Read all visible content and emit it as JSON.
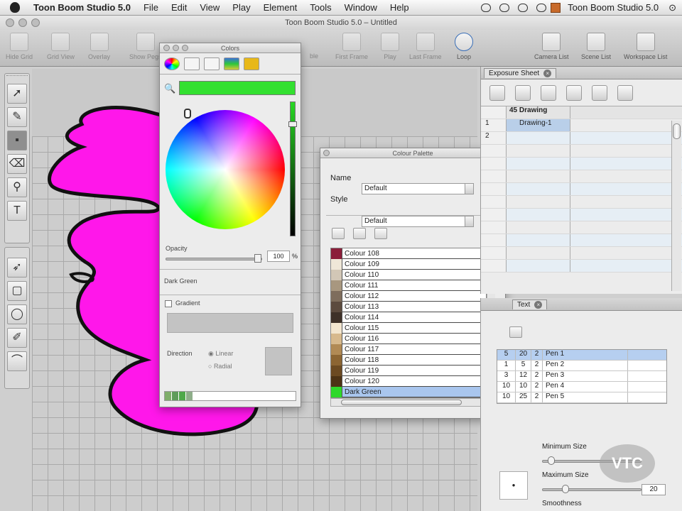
{
  "menubar": {
    "app": "Toon Boom Studio 5.0",
    "items": [
      "File",
      "Edit",
      "View",
      "Play",
      "Element",
      "Tools",
      "Window",
      "Help"
    ],
    "right_app": "Toon Boom Studio 5.0"
  },
  "window_title": "Toon Boom Studio 5.0 – Untitled",
  "toolbar": {
    "left": [
      "Hide Grid",
      "Grid View",
      "Overlay",
      "Show Pegs"
    ],
    "frame_controls": [
      "First Frame",
      "Play",
      "Last Frame",
      "Loop"
    ],
    "right": [
      "Camera List",
      "Scene List",
      "Workspace List"
    ],
    "partial_label": "ble"
  },
  "colors_window": {
    "title": "Colors",
    "opacity_label": "Opacity",
    "opacity_value": "100",
    "opacity_unit": "%",
    "selected_color_name": "Dark Green",
    "gradient_label": "Gradient",
    "direction_label": "Direction",
    "direction_options": [
      "Linear",
      "Radial"
    ],
    "current_color": "#33e030"
  },
  "colour_palette": {
    "title": "Colour Palette",
    "name_label": "Name",
    "name_value": "Default",
    "style_label": "Style",
    "style_value": "Default",
    "items": [
      {
        "name": "Colour 108",
        "color": "#8b1e3a"
      },
      {
        "name": "Colour 109",
        "color": "#efe7d8"
      },
      {
        "name": "Colour 110",
        "color": "#d2c7b6"
      },
      {
        "name": "Colour 111",
        "color": "#a8977f"
      },
      {
        "name": "Colour 112",
        "color": "#7e6d5c"
      },
      {
        "name": "Colour 113",
        "color": "#5c4b3e"
      },
      {
        "name": "Colour 114",
        "color": "#3e3128"
      },
      {
        "name": "Colour 115",
        "color": "#f3e6cf"
      },
      {
        "name": "Colour 116",
        "color": "#d7b98d"
      },
      {
        "name": "Colour 117",
        "color": "#b18a55"
      },
      {
        "name": "Colour 118",
        "color": "#8c6533"
      },
      {
        "name": "Colour 119",
        "color": "#6c4a22"
      },
      {
        "name": "Colour 120",
        "color": "#4d3315"
      },
      {
        "name": "Dark Green",
        "color": "#2ed82a"
      }
    ]
  },
  "exposure_sheet": {
    "tab": "Exposure Sheet",
    "column_header": "Drawing",
    "column_prefix": "45",
    "rows": [
      {
        "num": "1",
        "cell": "Drawing-1"
      },
      {
        "num": "2",
        "cell": ""
      },
      {
        "num": "",
        "cell": ""
      },
      {
        "num": "",
        "cell": ""
      },
      {
        "num": "",
        "cell": ""
      },
      {
        "num": "",
        "cell": ""
      },
      {
        "num": "",
        "cell": ""
      },
      {
        "num": "",
        "cell": ""
      },
      {
        "num": "",
        "cell": ""
      },
      {
        "num": "",
        "cell": ""
      },
      {
        "num": "",
        "cell": ""
      },
      {
        "num": "",
        "cell": ""
      }
    ]
  },
  "text_panel": {
    "tab": "Text",
    "pens": [
      {
        "a": "5",
        "b": "20",
        "c": "2",
        "name": "Pen 1"
      },
      {
        "a": "1",
        "b": "5",
        "c": "2",
        "name": "Pen 2"
      },
      {
        "a": "3",
        "b": "12",
        "c": "2",
        "name": "Pen 3"
      },
      {
        "a": "10",
        "b": "10",
        "c": "2",
        "name": "Pen 4"
      },
      {
        "a": "10",
        "b": "25",
        "c": "2",
        "name": "Pen 5"
      }
    ],
    "min_size_label": "Minimum Size",
    "max_size_label": "Maximum Size",
    "max_size_value": "20",
    "smoothness_label": "Smoothness"
  },
  "watermark": "VTC",
  "colors": {
    "magenta": "#ff17ea",
    "green": "#2ed82a",
    "selection": "#a9c6ee"
  }
}
